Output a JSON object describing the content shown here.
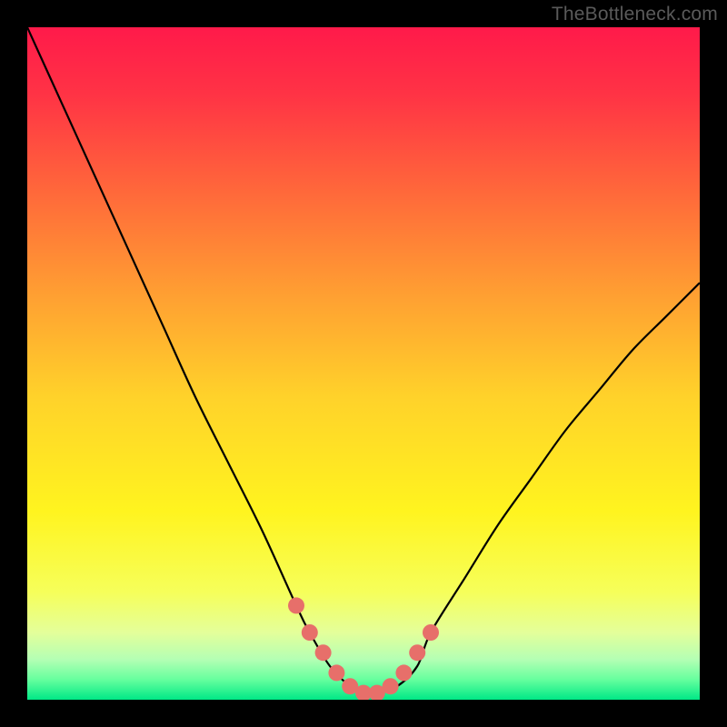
{
  "watermark": "TheBottleneck.com",
  "colors": {
    "frame": "#000000",
    "curve": "#000000",
    "marker_fill": "#e76f6a",
    "marker_stroke": "#b94d4a",
    "gradient_stops": [
      {
        "offset": "0%",
        "color": "#ff1a4a"
      },
      {
        "offset": "10%",
        "color": "#ff3345"
      },
      {
        "offset": "25%",
        "color": "#ff6a3a"
      },
      {
        "offset": "40%",
        "color": "#ffa032"
      },
      {
        "offset": "55%",
        "color": "#ffd22a"
      },
      {
        "offset": "72%",
        "color": "#fff41f"
      },
      {
        "offset": "84%",
        "color": "#f6ff5a"
      },
      {
        "offset": "90%",
        "color": "#e4ff9a"
      },
      {
        "offset": "94%",
        "color": "#b4ffb4"
      },
      {
        "offset": "97%",
        "color": "#66ff9e"
      },
      {
        "offset": "100%",
        "color": "#00e886"
      }
    ]
  },
  "chart_data": {
    "type": "line",
    "title": "",
    "xlabel": "",
    "ylabel": "",
    "xlim": [
      0,
      100
    ],
    "ylim": [
      0,
      100
    ],
    "series": [
      {
        "name": "bottleneck-curve",
        "x": [
          0,
          5,
          10,
          15,
          20,
          25,
          30,
          35,
          40,
          42,
          45,
          48,
          50,
          52,
          55,
          58,
          60,
          65,
          70,
          75,
          80,
          85,
          90,
          95,
          100
        ],
        "y": [
          100,
          89,
          78,
          67,
          56,
          45,
          35,
          25,
          14,
          10,
          5,
          2,
          1,
          1,
          2,
          5,
          10,
          18,
          26,
          33,
          40,
          46,
          52,
          57,
          62
        ]
      }
    ],
    "markers": {
      "name": "highlighted-points",
      "x": [
        40,
        42,
        44,
        46,
        48,
        50,
        52,
        54,
        56,
        58,
        60
      ],
      "y": [
        14,
        10,
        7,
        4,
        2,
        1,
        1,
        2,
        4,
        7,
        10
      ]
    }
  }
}
